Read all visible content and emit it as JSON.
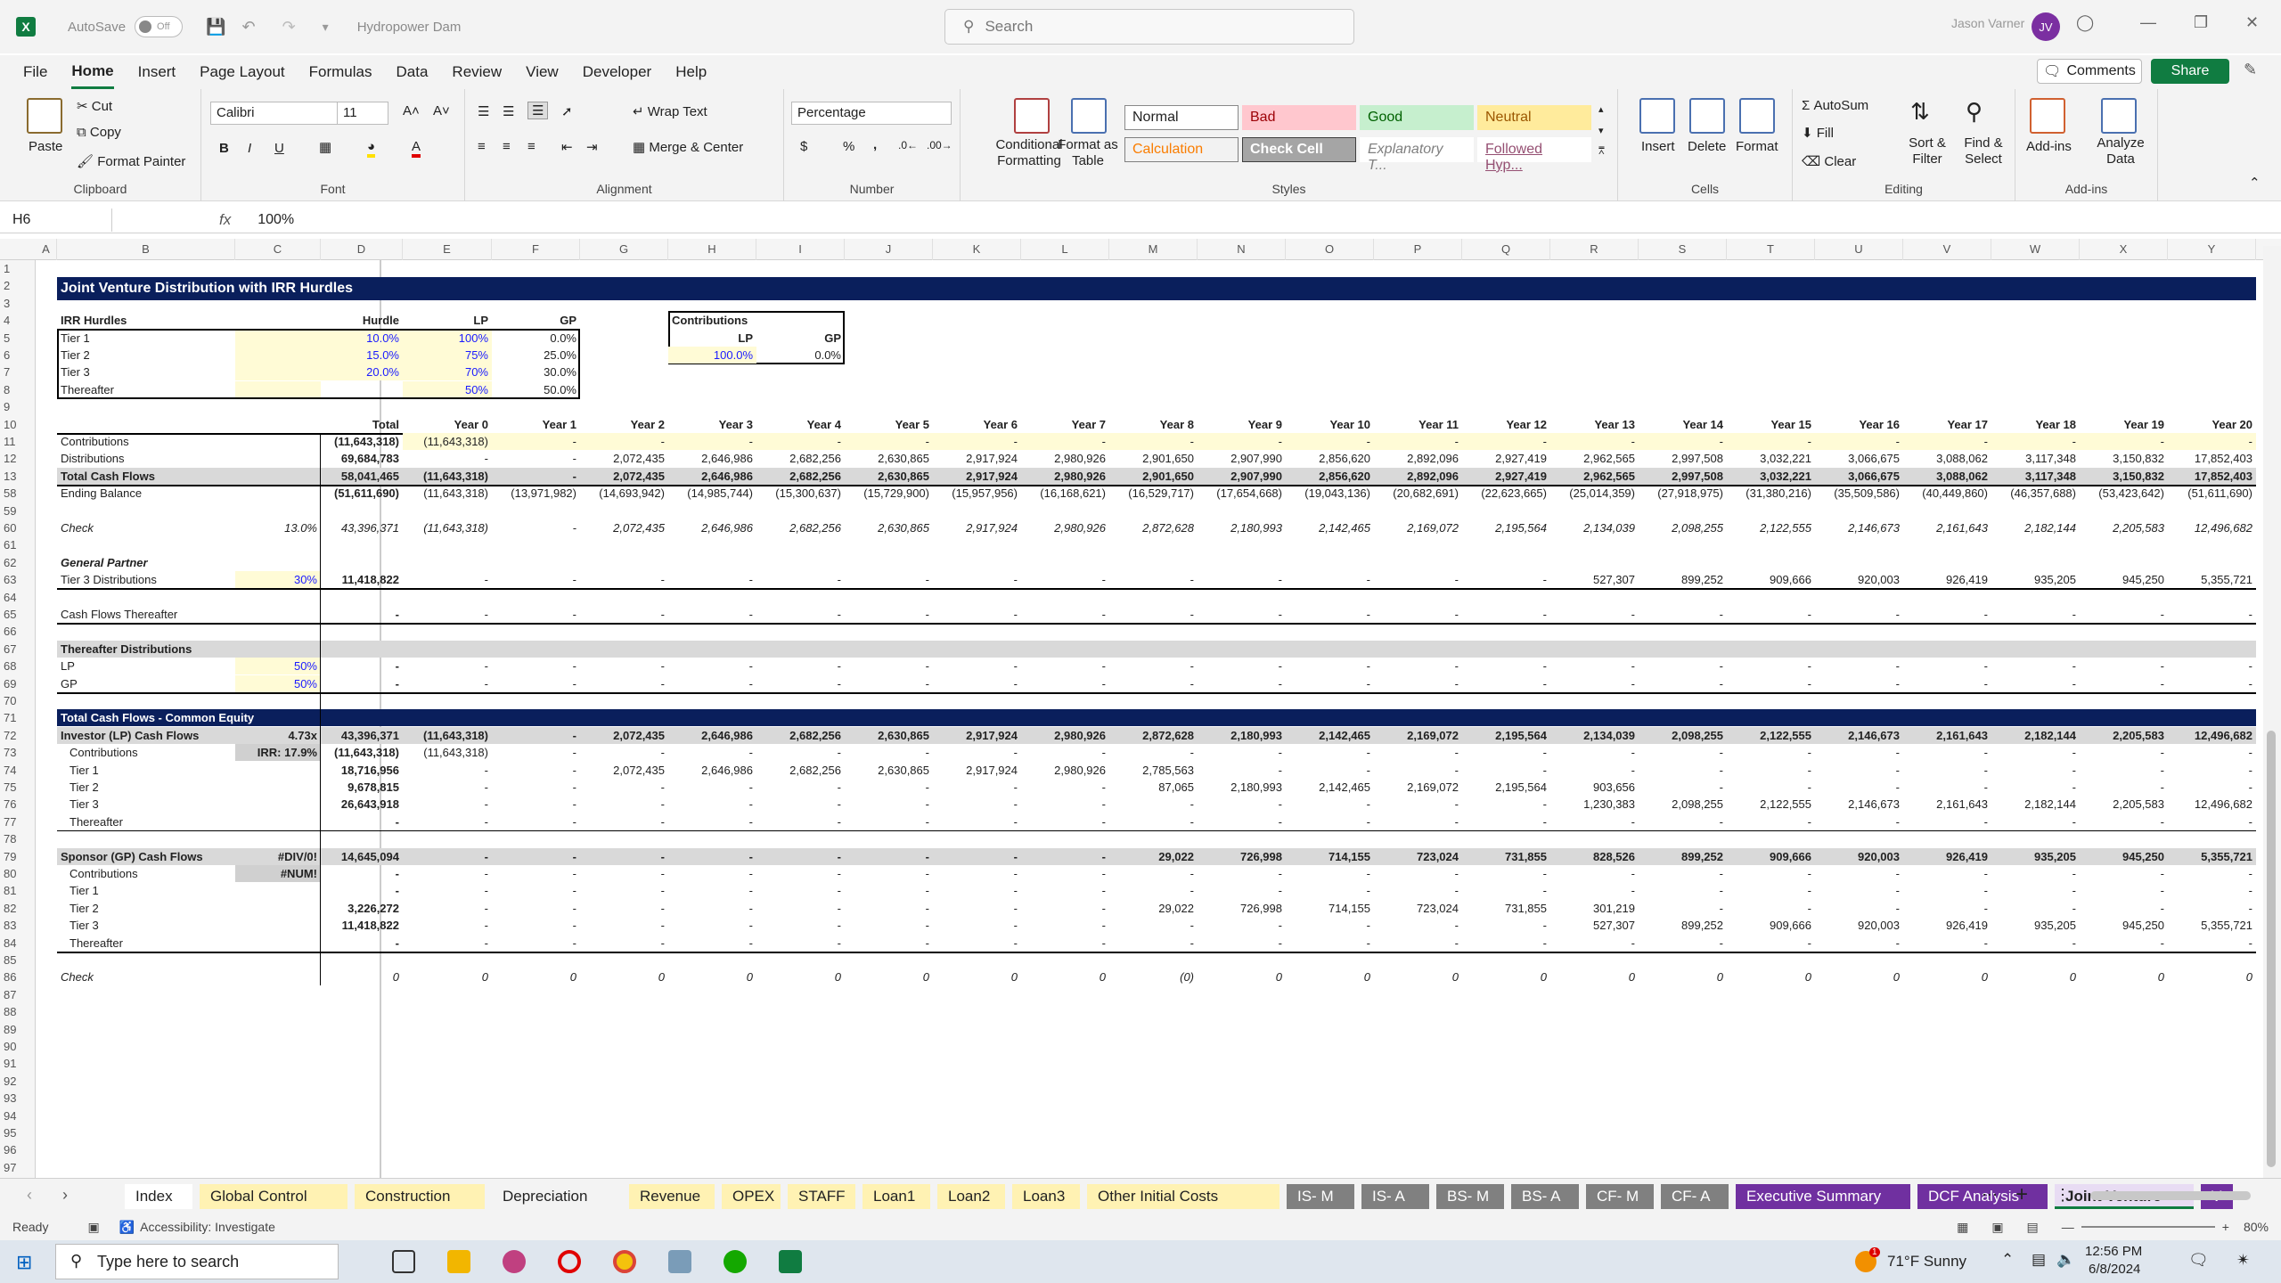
{
  "title": {
    "autosave": "AutoSave",
    "toggle": "Off",
    "filename": "Hydropower Dam",
    "search": "Search",
    "user": "Jason Varner",
    "initials": "JV"
  },
  "menu": [
    "File",
    "Home",
    "Insert",
    "Page Layout",
    "Formulas",
    "Data",
    "Review",
    "View",
    "Developer",
    "Help"
  ],
  "buttons": {
    "comments": "Comments",
    "share": "Share"
  },
  "ribbon": {
    "clipboard": {
      "label": "Clipboard",
      "paste": "Paste",
      "cut": "Cut",
      "copy": "Copy",
      "painter": "Format Painter"
    },
    "font": {
      "label": "Font",
      "name": "Calibri",
      "size": "11",
      "bold": "B",
      "italic": "I",
      "underline": "U"
    },
    "alignment": {
      "label": "Alignment",
      "wrap": "Wrap Text",
      "merge": "Merge & Center"
    },
    "number": {
      "label": "Number",
      "format": "Percentage",
      "currency": "$",
      "percent": "%",
      "comma": ","
    },
    "styles": {
      "label": "Styles",
      "conditional": "Conditional Formatting",
      "format_table": "Format as Table",
      "cells": [
        [
          "Normal",
          "Bad",
          "Good",
          "Neutral"
        ],
        [
          "Calculation",
          "Check Cell",
          "Explanatory T...",
          "Followed Hyp..."
        ]
      ]
    },
    "cells": {
      "label": "Cells",
      "insert": "Insert",
      "delete": "Delete",
      "format": "Format"
    },
    "editing": {
      "label": "Editing",
      "autosum": "AutoSum",
      "fill": "Fill",
      "clear": "Clear",
      "sort": "Sort & Filter",
      "find": "Find & Select"
    },
    "addins": {
      "label": "Add-ins",
      "addins": "Add-ins",
      "analyze": "Analyze Data"
    }
  },
  "formula": {
    "namebox": "H6",
    "fx": "fx",
    "value": "100%"
  },
  "columns": [
    "A",
    "B",
    "C",
    "D",
    "E",
    "F",
    "G",
    "H",
    "I",
    "J",
    "K",
    "L",
    "M",
    "N",
    "O",
    "P",
    "Q",
    "R",
    "S",
    "T",
    "U",
    "V",
    "W",
    "X",
    "Y"
  ],
  "rows": [
    "1",
    "2",
    "3",
    "4",
    "5",
    "6",
    "7",
    "8",
    "9",
    "10",
    "11",
    "12",
    "13",
    "58",
    "59",
    "60",
    "61",
    "62",
    "63",
    "64",
    "65",
    "66",
    "67",
    "68",
    "69",
    "70",
    "71",
    "72",
    "73",
    "74",
    "75",
    "76",
    "77",
    "78",
    "79",
    "80",
    "81",
    "82",
    "83",
    "84",
    "85",
    "86",
    "87",
    "88",
    "89",
    "90",
    "91",
    "92",
    "93",
    "94",
    "95",
    "96",
    "97"
  ],
  "sheet": {
    "title": "Joint Venture Distribution with IRR Hurdles",
    "hurdles": {
      "hdr": [
        "IRR Hurdles",
        "Hurdle",
        "LP",
        "GP"
      ],
      "rows": [
        [
          "Tier 1",
          "10.0%",
          "100%",
          "0.0%"
        ],
        [
          "Tier 2",
          "15.0%",
          "75%",
          "25.0%"
        ],
        [
          "Tier 3",
          "20.0%",
          "70%",
          "30.0%"
        ],
        [
          "Thereafter",
          "",
          "50%",
          "50.0%"
        ]
      ]
    },
    "contrib": {
      "title": "Contributions",
      "lp": "LP",
      "gp": "GP",
      "lpv": "100.0%",
      "gpv": "0.0%"
    },
    "years": [
      "Total",
      "Year 0",
      "Year 1",
      "Year 2",
      "Year 3",
      "Year 4",
      "Year 5",
      "Year 6",
      "Year 7",
      "Year 8",
      "Year 9",
      "Year 10",
      "Year 11",
      "Year 12",
      "Year 13",
      "Year 14",
      "Year 15",
      "Year 16",
      "Year 17",
      "Year 18",
      "Year 19",
      "Year 20"
    ],
    "lines": [
      {
        "r": 11,
        "label": "Contributions",
        "c": "",
        "vals": [
          "(11,643,318)",
          "(11,643,318)",
          "-",
          "-",
          "-",
          "-",
          "-",
          "-",
          "-",
          "-",
          "-",
          "-",
          "-",
          "-",
          "-",
          "-",
          "-",
          "-",
          "-",
          "-",
          "-",
          "-"
        ],
        "hl": true
      },
      {
        "r": 12,
        "label": "Distributions",
        "c": "",
        "vals": [
          "69,684,783",
          "-",
          "-",
          "2,072,435",
          "2,646,986",
          "2,682,256",
          "2,630,865",
          "2,917,924",
          "2,980,926",
          "2,901,650",
          "2,907,990",
          "2,856,620",
          "2,892,096",
          "2,927,419",
          "2,962,565",
          "2,997,508",
          "3,032,221",
          "3,066,675",
          "3,088,062",
          "3,117,348",
          "3,150,832",
          "17,852,403"
        ]
      },
      {
        "r": 13,
        "label": "Total Cash Flows",
        "c": "",
        "vals": [
          "58,041,465",
          "(11,643,318)",
          "-",
          "2,072,435",
          "2,646,986",
          "2,682,256",
          "2,630,865",
          "2,917,924",
          "2,980,926",
          "2,901,650",
          "2,907,990",
          "2,856,620",
          "2,892,096",
          "2,927,419",
          "2,962,565",
          "2,997,508",
          "3,032,221",
          "3,066,675",
          "3,088,062",
          "3,117,348",
          "3,150,832",
          "17,852,403"
        ],
        "grey": true,
        "bold": true
      },
      {
        "r": 58,
        "label": "Ending Balance",
        "c": "",
        "vals": [
          "(51,611,690)",
          "(11,643,318)",
          "(13,971,982)",
          "(14,693,942)",
          "(14,985,744)",
          "(15,300,637)",
          "(15,729,900)",
          "(15,957,956)",
          "(16,168,621)",
          "(16,529,717)",
          "(17,654,668)",
          "(19,043,136)",
          "(20,682,691)",
          "(22,623,665)",
          "(25,014,359)",
          "(27,918,975)",
          "(31,380,216)",
          "(35,509,586)",
          "(40,449,860)",
          "(46,357,688)",
          "(53,423,642)",
          "(51,611,690)"
        ]
      },
      {
        "r": 60,
        "label": "Check",
        "c": "13.0%",
        "vals": [
          "43,396,371",
          "(11,643,318)",
          "-",
          "2,072,435",
          "2,646,986",
          "2,682,256",
          "2,630,865",
          "2,917,924",
          "2,980,926",
          "2,872,628",
          "2,180,993",
          "2,142,465",
          "2,169,072",
          "2,195,564",
          "2,134,039",
          "2,098,255",
          "2,122,555",
          "2,146,673",
          "2,161,643",
          "2,182,144",
          "2,205,583",
          "12,496,682"
        ],
        "italic": true
      },
      {
        "r": 62,
        "label": "General Partner",
        "c": "",
        "vals": [],
        "bi": true
      },
      {
        "r": 63,
        "label": "Tier 3 Distributions",
        "c": "30%",
        "vals": [
          "11,418,822",
          "-",
          "-",
          "-",
          "-",
          "-",
          "-",
          "-",
          "-",
          "-",
          "-",
          "-",
          "-",
          "-",
          "527,307",
          "899,252",
          "909,666",
          "920,003",
          "926,419",
          "935,205",
          "945,250",
          "5,355,721"
        ],
        "cblue": true
      },
      {
        "r": 65,
        "label": "Cash Flows Thereafter",
        "c": "",
        "vals": [
          "-",
          "-",
          "-",
          "-",
          "-",
          "-",
          "-",
          "-",
          "-",
          "-",
          "-",
          "-",
          "-",
          "-",
          "-",
          "-",
          "-",
          "-",
          "-",
          "-",
          "-",
          "-"
        ]
      },
      {
        "r": 67,
        "label": "Thereafter Distributions",
        "c": "",
        "vals": [],
        "grey": true,
        "bold": true
      },
      {
        "r": 68,
        "label": "LP",
        "c": "50%",
        "vals": [
          "-",
          "-",
          "-",
          "-",
          "-",
          "-",
          "-",
          "-",
          "-",
          "-",
          "-",
          "-",
          "-",
          "-",
          "-",
          "-",
          "-",
          "-",
          "-",
          "-",
          "-",
          "-"
        ],
        "cblue": true
      },
      {
        "r": 69,
        "label": "GP",
        "c": "50%",
        "vals": [
          "-",
          "-",
          "-",
          "-",
          "-",
          "-",
          "-",
          "-",
          "-",
          "-",
          "-",
          "-",
          "-",
          "-",
          "-",
          "-",
          "-",
          "-",
          "-",
          "-",
          "-",
          "-"
        ],
        "cblue": true
      },
      {
        "r": 71,
        "label": "Total Cash Flows - Common Equity",
        "c": "",
        "vals": [],
        "banner": true
      },
      {
        "r": 72,
        "label": "Investor (LP) Cash Flows",
        "c": "4.73x",
        "vals": [
          "43,396,371",
          "(11,643,318)",
          "-",
          "2,072,435",
          "2,646,986",
          "2,682,256",
          "2,630,865",
          "2,917,924",
          "2,980,926",
          "2,872,628",
          "2,180,993",
          "2,142,465",
          "2,169,072",
          "2,195,564",
          "2,134,039",
          "2,098,255",
          "2,122,555",
          "2,146,673",
          "2,161,643",
          "2,182,144",
          "2,205,583",
          "12,496,682"
        ],
        "grey": true,
        "bold": true
      },
      {
        "r": 73,
        "label": "Contributions",
        "c": "IRR: 17.9%",
        "vals": [
          "(11,643,318)",
          "(11,643,318)",
          "-",
          "-",
          "-",
          "-",
          "-",
          "-",
          "-",
          "-",
          "-",
          "-",
          "-",
          "-",
          "-",
          "-",
          "-",
          "-",
          "-",
          "-",
          "-",
          "-"
        ],
        "indent": true,
        "cgrey": true
      },
      {
        "r": 74,
        "label": "Tier 1",
        "c": "",
        "vals": [
          "18,716,956",
          "-",
          "-",
          "2,072,435",
          "2,646,986",
          "2,682,256",
          "2,630,865",
          "2,917,924",
          "2,980,926",
          "2,785,563",
          "-",
          "-",
          "-",
          "-",
          "-",
          "-",
          "-",
          "-",
          "-",
          "-",
          "-",
          "-"
        ],
        "indent": true
      },
      {
        "r": 75,
        "label": "Tier 2",
        "c": "",
        "vals": [
          "9,678,815",
          "-",
          "-",
          "-",
          "-",
          "-",
          "-",
          "-",
          "-",
          "87,065",
          "2,180,993",
          "2,142,465",
          "2,169,072",
          "2,195,564",
          "903,656",
          "-",
          "-",
          "-",
          "-",
          "-",
          "-",
          "-"
        ],
        "indent": true
      },
      {
        "r": 76,
        "label": "Tier 3",
        "c": "",
        "vals": [
          "26,643,918",
          "-",
          "-",
          "-",
          "-",
          "-",
          "-",
          "-",
          "-",
          "-",
          "-",
          "-",
          "-",
          "-",
          "1,230,383",
          "2,098,255",
          "2,122,555",
          "2,146,673",
          "2,161,643",
          "2,182,144",
          "2,205,583",
          "12,496,682"
        ],
        "indent": true
      },
      {
        "r": 77,
        "label": "Thereafter",
        "c": "",
        "vals": [
          "-",
          "-",
          "-",
          "-",
          "-",
          "-",
          "-",
          "-",
          "-",
          "-",
          "-",
          "-",
          "-",
          "-",
          "-",
          "-",
          "-",
          "-",
          "-",
          "-",
          "-",
          "-"
        ],
        "indent": true
      },
      {
        "r": 79,
        "label": "Sponsor (GP) Cash Flows",
        "c": "#DIV/0!",
        "vals": [
          "14,645,094",
          "-",
          "-",
          "-",
          "-",
          "-",
          "-",
          "-",
          "-",
          "29,022",
          "726,998",
          "714,155",
          "723,024",
          "731,855",
          "828,526",
          "899,252",
          "909,666",
          "920,003",
          "926,419",
          "935,205",
          "945,250",
          "5,355,721"
        ],
        "grey": true,
        "bold": true
      },
      {
        "r": 80,
        "label": "Contributions",
        "c": "#NUM!",
        "vals": [
          "-",
          "-",
          "-",
          "-",
          "-",
          "-",
          "-",
          "-",
          "-",
          "-",
          "-",
          "-",
          "-",
          "-",
          "-",
          "-",
          "-",
          "-",
          "-",
          "-",
          "-",
          "-"
        ],
        "indent": true,
        "cgrey": true
      },
      {
        "r": 81,
        "label": "Tier 1",
        "c": "",
        "vals": [
          "-",
          "-",
          "-",
          "-",
          "-",
          "-",
          "-",
          "-",
          "-",
          "-",
          "-",
          "-",
          "-",
          "-",
          "-",
          "-",
          "-",
          "-",
          "-",
          "-",
          "-",
          "-"
        ],
        "indent": true
      },
      {
        "r": 82,
        "label": "Tier 2",
        "c": "",
        "vals": [
          "3,226,272",
          "-",
          "-",
          "-",
          "-",
          "-",
          "-",
          "-",
          "-",
          "29,022",
          "726,998",
          "714,155",
          "723,024",
          "731,855",
          "301,219",
          "-",
          "-",
          "-",
          "-",
          "-",
          "-",
          "-"
        ],
        "indent": true
      },
      {
        "r": 83,
        "label": "Tier 3",
        "c": "",
        "vals": [
          "11,418,822",
          "-",
          "-",
          "-",
          "-",
          "-",
          "-",
          "-",
          "-",
          "-",
          "-",
          "-",
          "-",
          "-",
          "527,307",
          "899,252",
          "909,666",
          "920,003",
          "926,419",
          "935,205",
          "945,250",
          "5,355,721"
        ],
        "indent": true
      },
      {
        "r": 84,
        "label": "Thereafter",
        "c": "",
        "vals": [
          "-",
          "-",
          "-",
          "-",
          "-",
          "-",
          "-",
          "-",
          "-",
          "-",
          "-",
          "-",
          "-",
          "-",
          "-",
          "-",
          "-",
          "-",
          "-",
          "-",
          "-",
          "-"
        ],
        "indent": true
      },
      {
        "r": 86,
        "label": "Check",
        "c": "",
        "vals": [
          "0",
          "0",
          "0",
          "0",
          "0",
          "0",
          "0",
          "0",
          "0",
          "(0)",
          "0",
          "0",
          "0",
          "0",
          "0",
          "0",
          "0",
          "0",
          "0",
          "0",
          "0",
          "0"
        ],
        "italic": true,
        "check": true
      }
    ]
  },
  "tabs": [
    {
      "name": "Index",
      "bg": "#ffffff",
      "fg": "#222"
    },
    {
      "name": "Global Control",
      "bg": "#fff2b3",
      "fg": "#222"
    },
    {
      "name": "Construction",
      "bg": "#fff2b3",
      "fg": "#222"
    },
    {
      "name": "Depreciation",
      "bg": "#f3f3f3",
      "fg": "#222"
    },
    {
      "name": "Revenue",
      "bg": "#fff2b3",
      "fg": "#222"
    },
    {
      "name": "OPEX",
      "bg": "#fff2b3",
      "fg": "#222"
    },
    {
      "name": "STAFF",
      "bg": "#fff2b3",
      "fg": "#222"
    },
    {
      "name": "Loan1",
      "bg": "#fff2b3",
      "fg": "#222"
    },
    {
      "name": "Loan2",
      "bg": "#fff2b3",
      "fg": "#222"
    },
    {
      "name": "Loan3",
      "bg": "#fff2b3",
      "fg": "#222"
    },
    {
      "name": "Other Initial Costs",
      "bg": "#fff2b3",
      "fg": "#222"
    },
    {
      "name": "IS- M",
      "bg": "#808080",
      "fg": "#fff"
    },
    {
      "name": "IS- A",
      "bg": "#808080",
      "fg": "#fff"
    },
    {
      "name": "BS- M",
      "bg": "#808080",
      "fg": "#fff"
    },
    {
      "name": "BS- A",
      "bg": "#808080",
      "fg": "#fff"
    },
    {
      "name": "CF- M",
      "bg": "#808080",
      "fg": "#fff"
    },
    {
      "name": "CF- A",
      "bg": "#808080",
      "fg": "#fff"
    },
    {
      "name": "Executive Summary",
      "bg": "#7030a0",
      "fg": "#fff"
    },
    {
      "name": "DCF Analysis",
      "bg": "#7030a0",
      "fg": "#fff"
    },
    {
      "name": "Joint Venture",
      "bg": "#e8dcf3",
      "fg": "#222"
    },
    {
      "name": "V",
      "bg": "#7030a0",
      "fg": "#fff"
    }
  ],
  "status": {
    "ready": "Ready",
    "accessibility": "Accessibility: Investigate",
    "zoom": "80%"
  },
  "taskbar": {
    "search": "Type here to search",
    "weather": "71°F  Sunny",
    "time": "12:56 PM",
    "date": "6/8/2024",
    "badge": "1"
  }
}
